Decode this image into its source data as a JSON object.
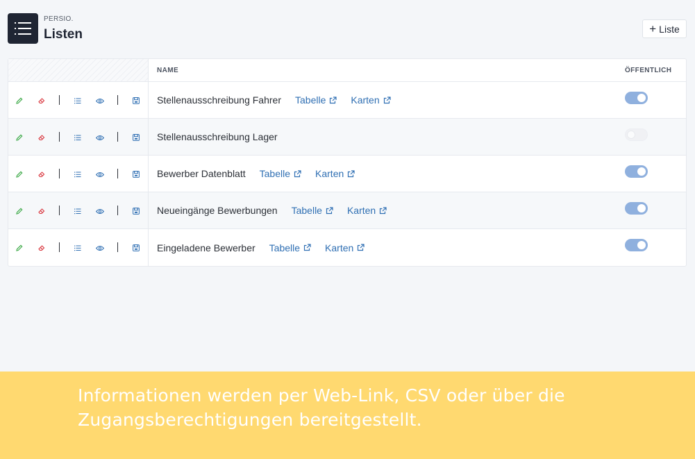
{
  "header": {
    "brand": "PERSIO.",
    "title": "Listen",
    "add_button_label": "Liste",
    "add_button_icon": "plus-icon"
  },
  "table": {
    "columns": {
      "name": "NAME",
      "public": "ÖFFENTLICH"
    },
    "row_actions": [
      "edit-icon",
      "delete-icon",
      "list-icon",
      "view-icon",
      "save-icon"
    ],
    "rows": [
      {
        "name": "Stellenausschreibung Fahrer",
        "links": [
          "Tabelle",
          "Karten"
        ],
        "public": true
      },
      {
        "name": "Stellenausschreibung Lager",
        "links": [],
        "public": false
      },
      {
        "name": "Bewerber Datenblatt",
        "links": [
          "Tabelle",
          "Karten"
        ],
        "public": true
      },
      {
        "name": "Neueingänge Bewerbungen",
        "links": [
          "Tabelle",
          "Karten"
        ],
        "public": true
      },
      {
        "name": "Eingeladene Bewerber",
        "links": [
          "Tabelle",
          "Karten"
        ],
        "public": true
      }
    ]
  },
  "banner": {
    "text": "Informationen werden per Web-Link, CSV oder über die Zugangsberechtigungen bereitgestellt."
  },
  "colors": {
    "header_icon_bg": "#1f2533",
    "link": "#2f6fb3",
    "edit": "#3aa845",
    "delete": "#d9363e",
    "action_blue": "#2f6fb3",
    "toggle_on": "#8fb0de",
    "banner": "#ffd970"
  }
}
